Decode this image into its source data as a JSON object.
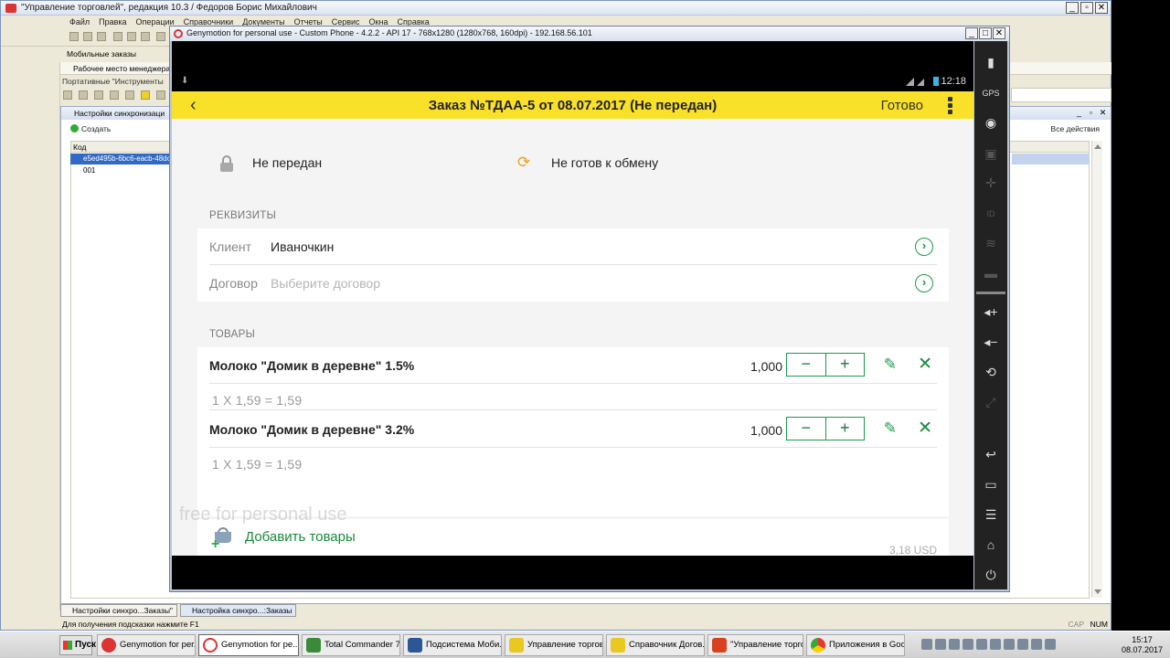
{
  "onec": {
    "title": "\"Управление торговлей\", редакция 10.3 / Федоров Борис Михайлович",
    "menu": [
      "Файл",
      "Правка",
      "Операции",
      "Справочники",
      "Документы",
      "Отчеты",
      "Сервис",
      "Окна",
      "Справка"
    ],
    "mobile_orders": "Мобильные заказы",
    "workplace": "Рабочее место менеджера по",
    "portable_tools": "Портативные \"Инструменты",
    "inner_window_title": "Настройки синхронизаци",
    "create_label": "Создать",
    "all_actions": "Все действия",
    "column_code": "Код",
    "rows": [
      "e5ed495b-6bc6-eacb-48dc",
      "001"
    ],
    "tabs": [
      "Настройки синхро...Заказы\"",
      "Настройка синхро...:Заказы"
    ],
    "hint": "Для получения подсказки нажмите F1",
    "caps": "CAP",
    "num": "NUM"
  },
  "genymotion": {
    "title": "Genymotion for personal use - Custom Phone - 4.2.2 - API 17 - 768x1280 (1280x768, 160dpi) - 192.168.56.101",
    "time": "12:18",
    "watermark": "free for personal use"
  },
  "app": {
    "title": "Заказ №ТДАА-5 от 08.07.2017 (Не передан)",
    "done": "Готово",
    "status_transfer": "Не передан",
    "status_exchange": "Не готов к обмену",
    "section_details": "РЕКВИЗИТЫ",
    "client_label": "Клиент",
    "client_value": "Иваночкин",
    "contract_label": "Договор",
    "contract_placeholder": "Выберите договор",
    "section_goods": "ТОВАРЫ",
    "products": [
      {
        "name": "Молоко \"Домик в деревне\" 1.5%",
        "qty": "1,000",
        "calc": "1  X 1,59  = 1,59"
      },
      {
        "name": "Молоко \"Домик в деревне\" 3.2%",
        "qty": "1,000",
        "calc": "1  X 1,59  = 1,59"
      }
    ],
    "add_goods": "Добавить товары",
    "bottom_sum": "3,18 USD"
  },
  "taskbar": {
    "start": "Пуск",
    "tasks": [
      "Genymotion for per...",
      "Genymotion for pe...",
      "Total Commander 7...",
      "Подсистема Моби...",
      "Управление торгов...",
      "Справочник Догов...",
      "\"Управление торго...",
      "Приложения в Goo..."
    ],
    "time": "15:17",
    "date": "08.07.2017"
  },
  "colors": {
    "appbar": "#f9e12a",
    "accent": "#1a9a4a"
  }
}
